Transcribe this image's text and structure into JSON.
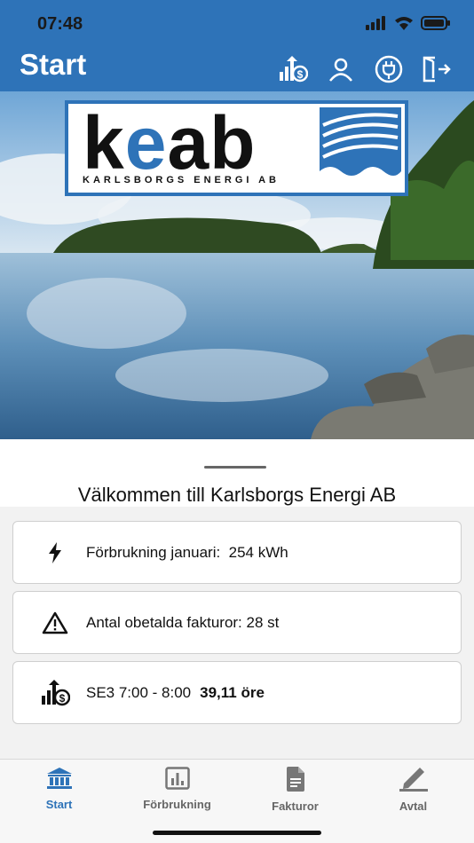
{
  "status": {
    "time": "07:48",
    "icons": [
      "signal-icon",
      "wifi-icon",
      "battery-icon"
    ]
  },
  "header": {
    "title": "Start",
    "actions": [
      "price-icon",
      "profile-icon",
      "plug-icon",
      "logout-icon"
    ]
  },
  "logo": {
    "word_pre": "k",
    "word_e": "e",
    "word_post": "ab",
    "subtitle": "KARLSBORGS ENERGI AB"
  },
  "welcome": "Välkommen till Karlsborgs Energi AB",
  "cards": [
    {
      "icon": "bolt-icon",
      "text": "Förbrukning januari:  254 kWh",
      "strong": ""
    },
    {
      "icon": "warning-icon",
      "text": "Antal obetalda fakturor: 28 st",
      "strong": ""
    },
    {
      "icon": "price-icon",
      "text": "SE3 7:00 - 8:00",
      "strong": "39,11 öre"
    }
  ],
  "tabs": [
    {
      "label": "Start",
      "icon": "bank-icon",
      "active": true
    },
    {
      "label": "Förbrukning",
      "icon": "chart-icon",
      "active": false
    },
    {
      "label": "Fakturor",
      "icon": "document-icon",
      "active": false
    },
    {
      "label": "Avtal",
      "icon": "pen-icon",
      "active": false
    }
  ],
  "colors": {
    "brand": "#2e73b8",
    "text": "#111111",
    "tab_inactive": "#666666"
  }
}
